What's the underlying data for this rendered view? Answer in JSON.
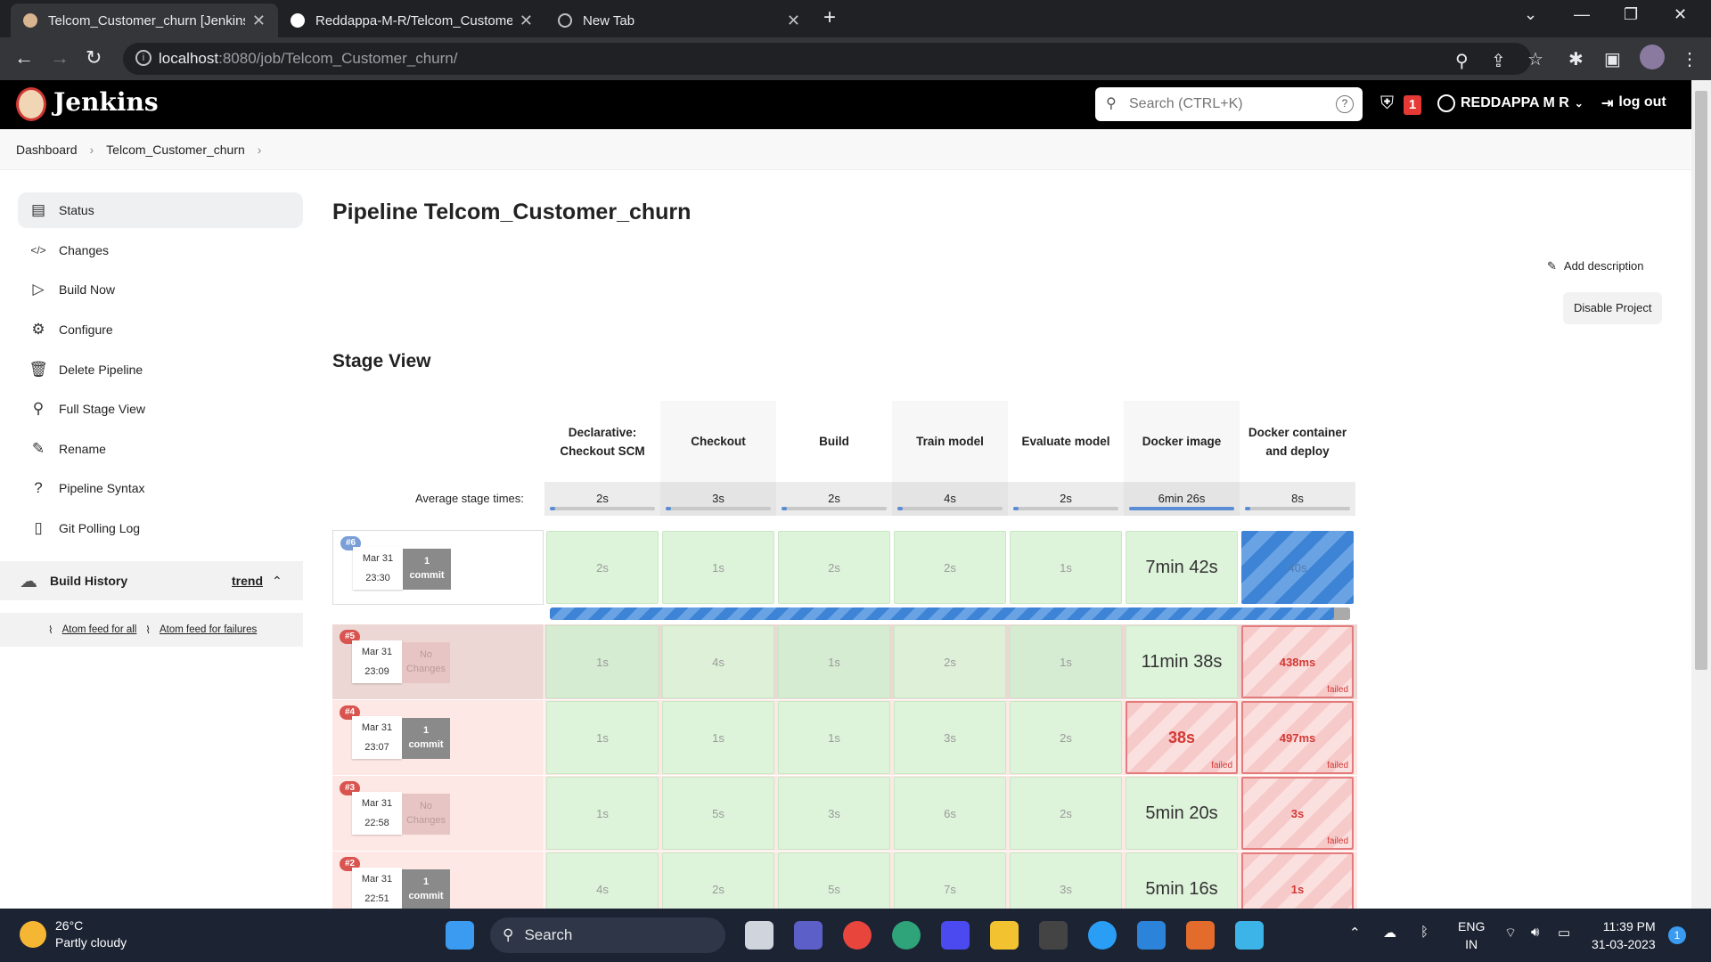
{
  "browser": {
    "tabs": [
      {
        "label": "Telcom_Customer_churn [Jenkins]",
        "active": true
      },
      {
        "label": "Reddappa-M-R/Telcom_Customer_churn",
        "active": false
      },
      {
        "label": "New Tab",
        "active": false
      }
    ],
    "url_host": "localhost",
    "url_rest": ":8080/job/Telcom_Customer_churn/"
  },
  "jenkins": {
    "brand": "Jenkins",
    "search_placeholder": "Search (CTRL+K)",
    "alert_count": "1",
    "user": "REDDAPPA M R",
    "logout": "log out"
  },
  "breadcrumb": [
    "Dashboard",
    "Telcom_Customer_churn"
  ],
  "sidebar": {
    "items": [
      {
        "label": "Status",
        "icon": "status-icon"
      },
      {
        "label": "Changes",
        "icon": "code-icon"
      },
      {
        "label": "Build Now",
        "icon": "play-icon"
      },
      {
        "label": "Configure",
        "icon": "gear-icon"
      },
      {
        "label": "Delete Pipeline",
        "icon": "trash-icon"
      },
      {
        "label": "Full Stage View",
        "icon": "search-icon"
      },
      {
        "label": "Rename",
        "icon": "pencil-icon"
      },
      {
        "label": "Pipeline Syntax",
        "icon": "help-icon"
      },
      {
        "label": "Git Polling Log",
        "icon": "clipboard-icon"
      }
    ],
    "build_history": {
      "title": "Build History",
      "trend": "trend"
    },
    "feeds": {
      "all": "Atom feed for all",
      "failures": "Atom feed for failures"
    }
  },
  "main": {
    "title": "Pipeline Telcom_Customer_churn",
    "add_description": "Add description",
    "disable_project": "Disable Project",
    "stage_view_title": "Stage View",
    "avg_label": "Average stage times:",
    "stages": [
      "Declarative: Checkout SCM",
      "Checkout",
      "Build",
      "Train model",
      "Evaluate model",
      "Docker image",
      "Docker container and deploy"
    ],
    "avg_times": [
      "2s",
      "3s",
      "2s",
      "4s",
      "2s",
      "6min 26s",
      "8s"
    ],
    "avg_fill": [
      0.05,
      0.05,
      0.05,
      0.05,
      0.05,
      1.0,
      0.05
    ],
    "builds": [
      {
        "num": "#6",
        "date": "Mar 31",
        "time": "23:30",
        "commit_line1": "1",
        "commit_line2": "commit",
        "cells": [
          "2s",
          "1s",
          "2s",
          "2s",
          "1s",
          "7min 42s",
          "40s"
        ],
        "status": [
          "ok",
          "ok",
          "ok",
          "ok",
          "ok",
          "ok",
          "running"
        ],
        "failed_label": ""
      },
      {
        "num": "#5",
        "date": "Mar 31",
        "time": "23:09",
        "commit_line1": "No",
        "commit_line2": "Changes",
        "cells": [
          "1s",
          "4s",
          "1s",
          "2s",
          "1s",
          "11min 38s",
          "438ms"
        ],
        "status": [
          "ok",
          "ok",
          "ok",
          "ok",
          "ok",
          "ok",
          "failed"
        ],
        "failed_label": "failed"
      },
      {
        "num": "#4",
        "date": "Mar 31",
        "time": "23:07",
        "commit_line1": "1",
        "commit_line2": "commit",
        "cells": [
          "1s",
          "1s",
          "1s",
          "3s",
          "2s",
          "38s",
          "497ms"
        ],
        "status": [
          "ok",
          "ok",
          "ok",
          "ok",
          "ok",
          "failed",
          "failed"
        ],
        "failed_label": "failed"
      },
      {
        "num": "#3",
        "date": "Mar 31",
        "time": "22:58",
        "commit_line1": "No",
        "commit_line2": "Changes",
        "cells": [
          "1s",
          "5s",
          "3s",
          "6s",
          "2s",
          "5min 20s",
          "3s"
        ],
        "status": [
          "ok",
          "ok",
          "ok",
          "ok",
          "ok",
          "ok",
          "failed"
        ],
        "failed_label": "failed"
      },
      {
        "num": "#2",
        "date": "Mar 31",
        "time": "22:51",
        "commit_line1": "1",
        "commit_line2": "commit",
        "cells": [
          "4s",
          "2s",
          "5s",
          "7s",
          "3s",
          "5min 16s",
          "1s"
        ],
        "status": [
          "ok",
          "ok",
          "ok",
          "ok",
          "ok",
          "ok",
          "failed"
        ],
        "failed_label": ""
      }
    ],
    "running_progress": 0.98
  },
  "taskbar": {
    "temp": "26°C",
    "weather": "Partly cloudy",
    "search": "Search",
    "lang1": "ENG",
    "lang2": "IN",
    "time": "11:39 PM",
    "date": "31-03-2023",
    "notifications": "1"
  }
}
